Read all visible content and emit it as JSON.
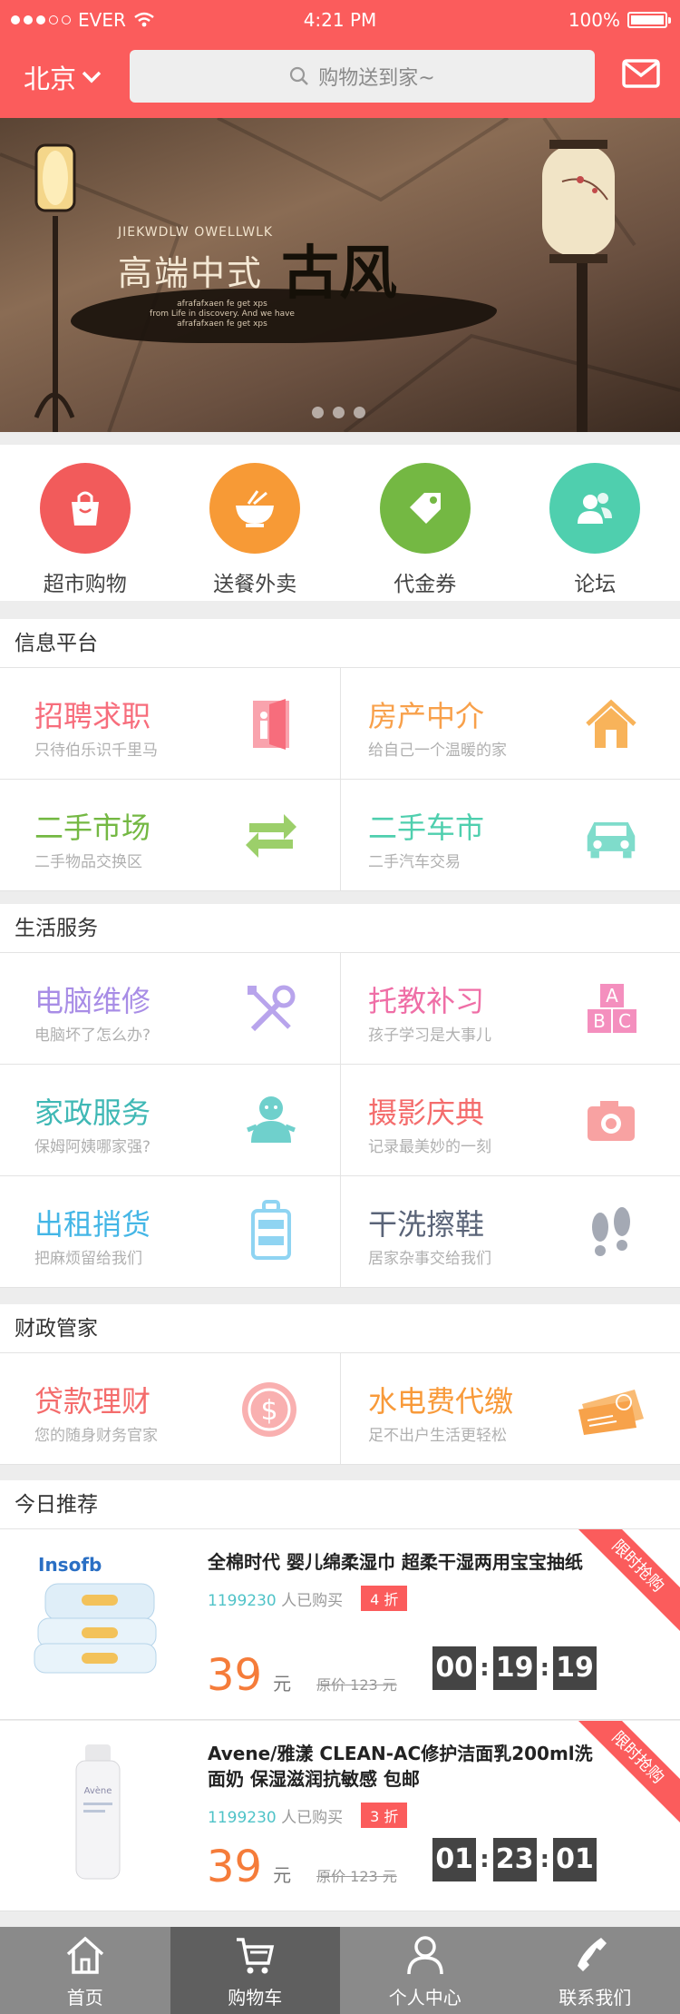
{
  "status_bar": {
    "carrier": "EVER",
    "time": "4:21 PM",
    "battery": "100%"
  },
  "header": {
    "city": "北京",
    "search_placeholder": "购物送到家~"
  },
  "banner": {
    "subtitle": "JIEKWDLW OWELLWLK",
    "title": "高端中式",
    "calligraphy": "古风",
    "small_text": "afrafafxaen fe get xps\nfrom Life in discovery. And we have\nafrafafxaen fe get xps",
    "active_dot": 0,
    "dot_count": 3
  },
  "categories": [
    {
      "label": "超市购物",
      "color": "#f25b5b",
      "icon": "shopping-bag-icon"
    },
    {
      "label": "送餐外卖",
      "color": "#f79a36",
      "icon": "noodle-bowl-icon"
    },
    {
      "label": "代金券",
      "color": "#74b843",
      "icon": "tag-icon"
    },
    {
      "label": "论坛",
      "color": "#4fcfae",
      "icon": "users-icon"
    }
  ],
  "sections": {
    "info": "信息平台",
    "life": "生活服务",
    "finance": "财政管家",
    "today": "今日推荐"
  },
  "info_items": [
    {
      "title": "招聘求职",
      "sub": "只待伯乐识千里马",
      "color": "#f76d7c",
      "icon": "door-icon"
    },
    {
      "title": "房产中介",
      "sub": "给自己一个温暖的家",
      "color": "#f8a04a",
      "icon": "house-icon"
    },
    {
      "title": "二手市场",
      "sub": "二手物品交换区",
      "color": "#74b843",
      "icon": "exchange-arrows-icon"
    },
    {
      "title": "二手车市",
      "sub": "二手汽车交易",
      "color": "#4fcfae",
      "icon": "car-icon"
    }
  ],
  "life_items": [
    {
      "title": "电脑维修",
      "sub": "电脑坏了怎么办?",
      "color": "#a88de6",
      "icon": "tools-icon"
    },
    {
      "title": "托教补习",
      "sub": "孩子学习是大事儿",
      "color": "#ef6ea6",
      "icon": "abc-blocks-icon"
    },
    {
      "title": "家政服务",
      "sub": "保姆阿姨哪家强?",
      "color": "#3fb8b5",
      "icon": "nanny-icon"
    },
    {
      "title": "摄影庆典",
      "sub": "记录最美妙的一刻",
      "color": "#f46c6c",
      "icon": "camera-icon"
    },
    {
      "title": "出租捎货",
      "sub": "把麻烦留给我们",
      "color": "#44b6e6",
      "icon": "luggage-icon"
    },
    {
      "title": "干洗擦鞋",
      "sub": "居家杂事交给我们",
      "color": "#5a6478",
      "icon": "footprints-icon"
    }
  ],
  "finance_items": [
    {
      "title": "贷款理财",
      "sub": "您的随身财务官家",
      "color": "#f46c6c",
      "icon": "dollar-coin-icon"
    },
    {
      "title": "水电费代缴",
      "sub": "足不出户生活更轻松",
      "color": "#f89a3a",
      "icon": "bill-icon"
    }
  ],
  "products": [
    {
      "name": "全棉时代 婴儿绵柔湿巾 超柔干湿两用宝宝抽纸",
      "sold_count": "1199230",
      "sold_unit": "人已购买",
      "discount": "4 折",
      "price": "39",
      "yuan": "元",
      "orig": "原价 123 元",
      "timer": [
        "00",
        "19",
        "19"
      ],
      "ribbon": "限时抢购",
      "brand": "Insofb"
    },
    {
      "name": "Avene/雅漾 CLEAN-AC修护洁面乳200ml洗面奶 保湿滋润抗敏感 包邮",
      "sold_count": "1199230",
      "sold_unit": "人已购买",
      "discount": "3 折",
      "price": "39",
      "yuan": "元",
      "orig": "原价 123 元",
      "timer": [
        "01",
        "23",
        "01"
      ],
      "ribbon": "限时抢购",
      "brand": "Avène"
    }
  ],
  "tabs": [
    {
      "label": "首页",
      "icon": "home-icon",
      "active": false
    },
    {
      "label": "购物车",
      "icon": "cart-icon",
      "active": true
    },
    {
      "label": "个人中心",
      "icon": "user-icon",
      "active": false
    },
    {
      "label": "联系我们",
      "icon": "phone-icon",
      "active": false
    }
  ]
}
